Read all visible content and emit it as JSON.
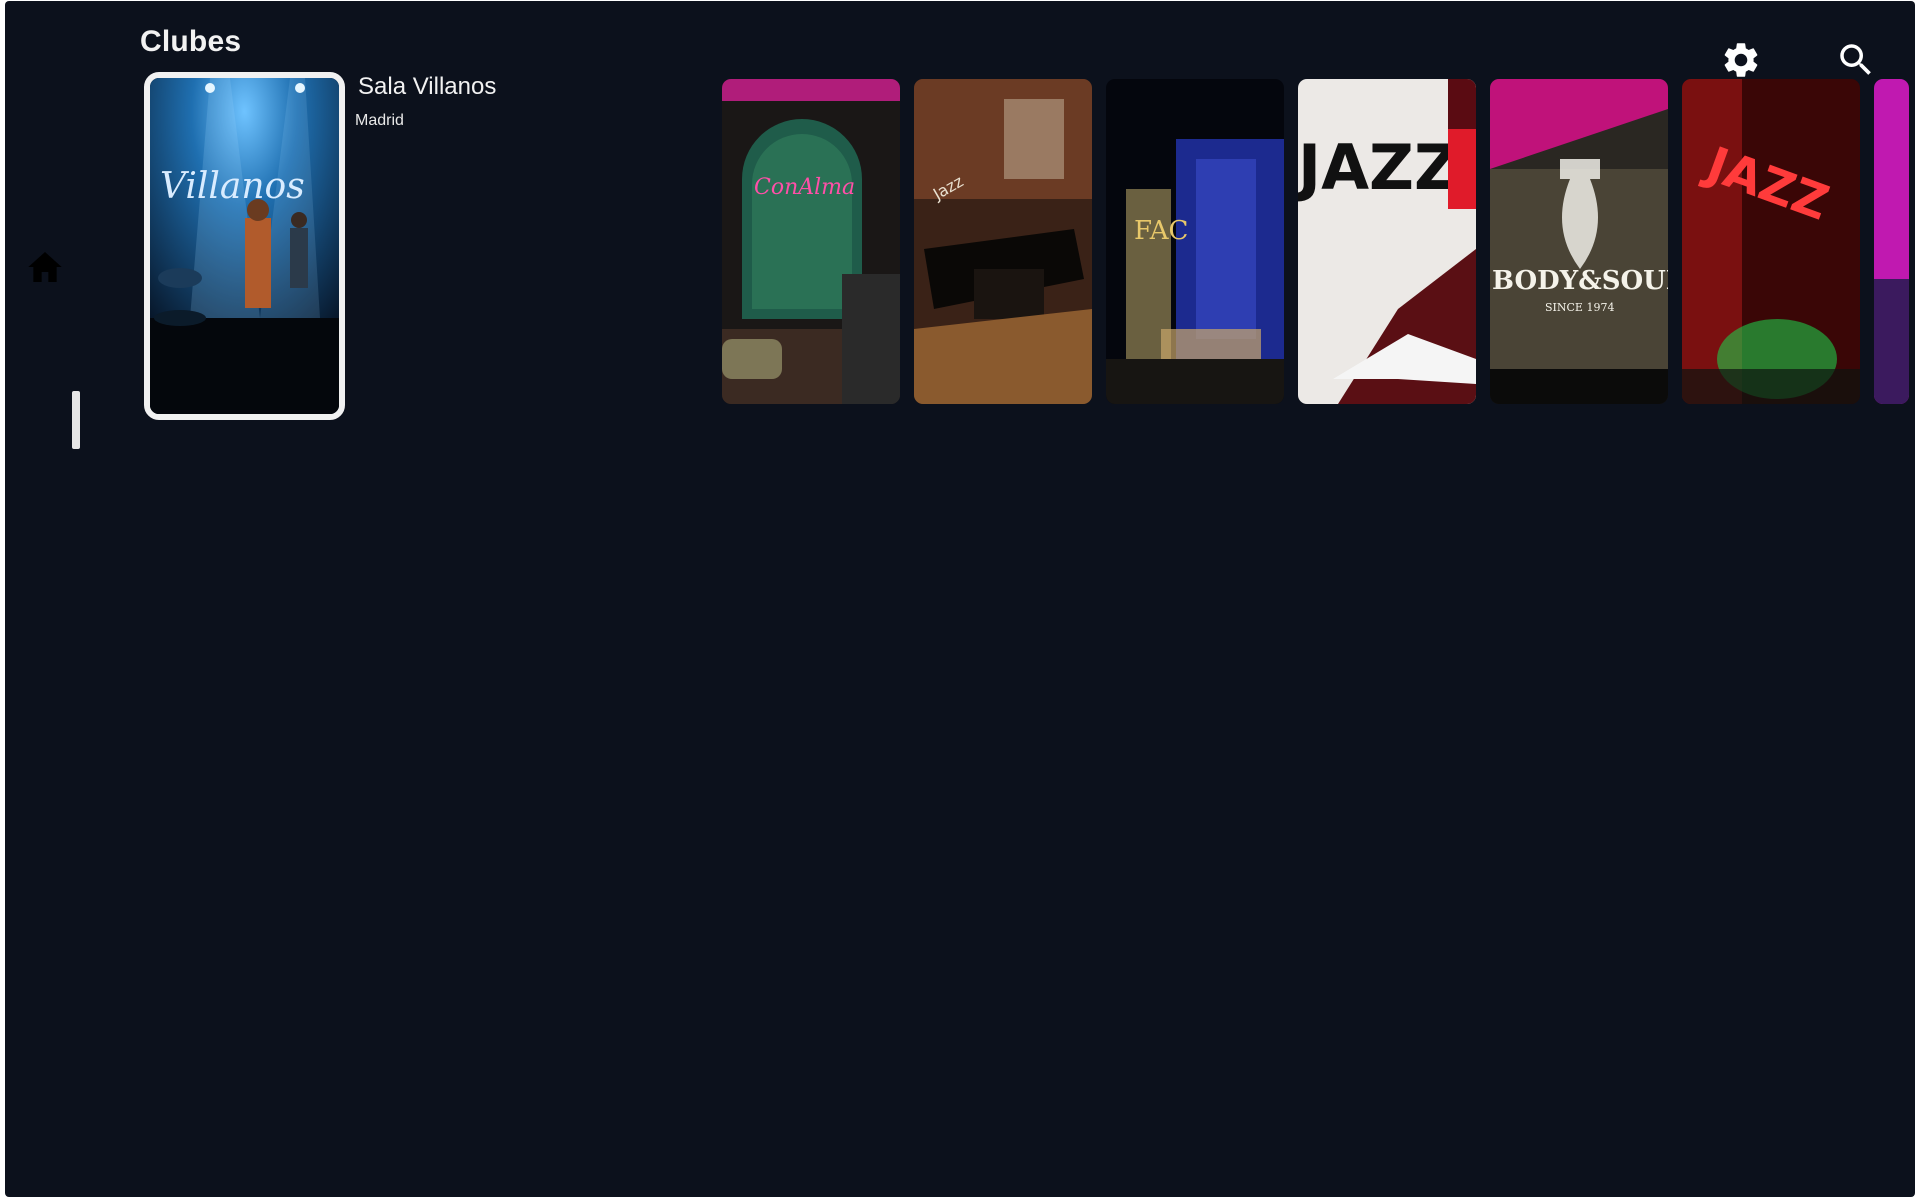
{
  "header": {
    "title": "Clubes"
  },
  "nav": {
    "home_icon": "home-icon",
    "settings_icon": "gear-icon",
    "search_icon": "search-icon"
  },
  "featured": {
    "name": "Sala Villanos",
    "city": "Madrid",
    "poster_sign": "Villanos"
  },
  "thumbnails": [
    {
      "sign": "ConAlma"
    },
    {
      "sign": "Jazz"
    },
    {
      "sign": "FAC"
    },
    {
      "sign": "JAZZ"
    },
    {
      "sign": "BODY&SOUL",
      "sub": "SINCE 1974"
    },
    {
      "sign": "JAZZ"
    },
    {
      "sign": ""
    }
  ],
  "colors": {
    "background": "#0c111c",
    "text": "#f2f2f2",
    "focus_border": "#f1f1f1",
    "neon_pink": "#ff4fa8",
    "stage_blue": "#1f6fb0"
  }
}
